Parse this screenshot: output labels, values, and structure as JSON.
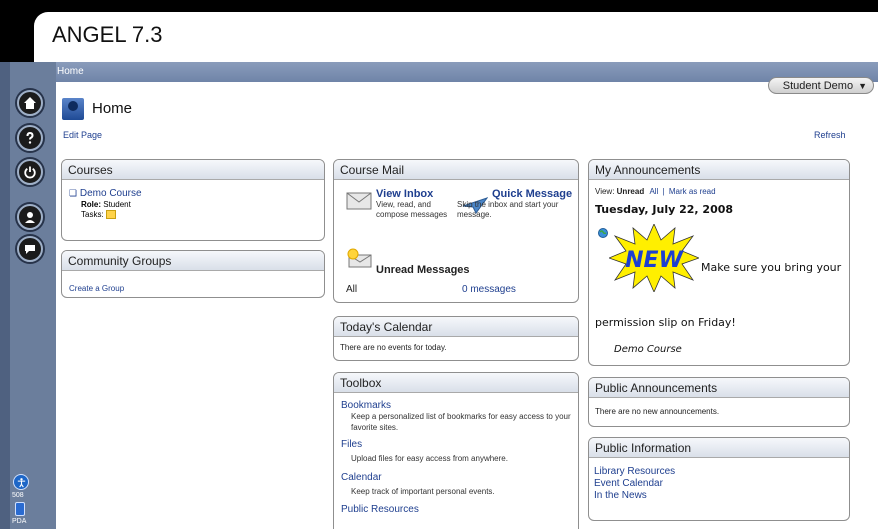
{
  "app": {
    "title": "ANGEL 7.3"
  },
  "breadcrumb": "Home",
  "user": {
    "name": "Student Demo",
    "caret": "▼"
  },
  "page": {
    "title": "Home",
    "edit_label": "Edit Page",
    "refresh_label": "Refresh"
  },
  "rail": {
    "a11y_label": "508",
    "pda_label": "PDA",
    "a11y_glyph": "⛹"
  },
  "courses": {
    "title": "Courses",
    "course_name": "Demo Course",
    "role_label": "Role:",
    "role_value": "Student",
    "tasks_label": "Tasks:"
  },
  "groups": {
    "title": "Community Groups",
    "create_label": "Create a Group"
  },
  "mail": {
    "title": "Course Mail",
    "view_inbox": "View Inbox",
    "view_inbox_desc": "View, read, and compose messages",
    "quick_message": "Quick Message",
    "quick_message_desc": "Skip the inbox and start your message.",
    "unread_title": "Unread Messages",
    "unread_scope": "All",
    "unread_count": "0 messages"
  },
  "calendar": {
    "title": "Today's Calendar",
    "empty": "There are no events for today."
  },
  "toolbox": {
    "title": "Toolbox",
    "items": [
      {
        "label": "Bookmarks",
        "desc": "Keep a personalized list of bookmarks for easy access to your favorite sites."
      },
      {
        "label": "Files",
        "desc": "Upload files for easy access from anywhere."
      },
      {
        "label": "Calendar",
        "desc": "Keep track of important personal events."
      },
      {
        "label": "Public Resources",
        "desc": ""
      }
    ]
  },
  "announcements": {
    "title": "My Announcements",
    "view_label": "View:",
    "unread_label": "Unread",
    "all_label": "All",
    "separator": "|",
    "mark_read_label": "Mark as read",
    "date": "Tuesday, July 22, 2008",
    "new_badge": "NEW",
    "message_1": "Make sure you bring your",
    "message_2": "permission slip on Friday!",
    "source": "Demo Course"
  },
  "public_announcements": {
    "title": "Public Announcements",
    "empty": "There are no new announcements."
  },
  "public_info": {
    "title": "Public Information",
    "links": [
      "Library Resources",
      "Event Calendar",
      "In the News"
    ]
  },
  "colors": {
    "link": "#1f3f8f",
    "rail": "#6b7e9c",
    "new_star": "#ffef00",
    "new_text": "#1c3fd1"
  }
}
